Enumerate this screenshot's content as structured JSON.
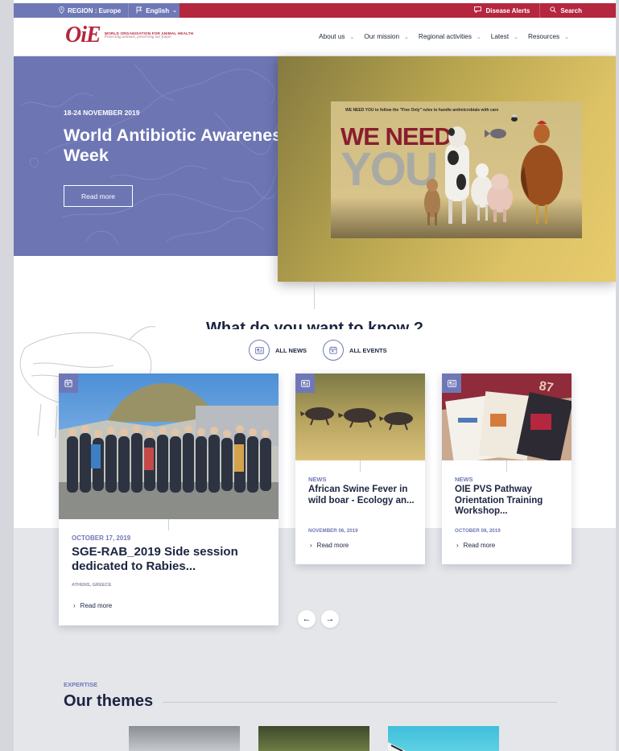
{
  "topbar": {
    "region_label": "REGION : Europe",
    "language_label": "English",
    "disease_alerts_label": "Disease Alerts",
    "search_label": "Search"
  },
  "header": {
    "logo_mark": "OiE",
    "logo_name": "WORLD ORGANISATION FOR ANIMAL HEALTH",
    "logo_tagline": "Protecting animals, preserving our future",
    "nav": [
      {
        "label": "About us"
      },
      {
        "label": "Our mission"
      },
      {
        "label": "Regional activities"
      },
      {
        "label": "Latest"
      },
      {
        "label": "Resources"
      }
    ]
  },
  "hero": {
    "date": "18-24 NOVEMBER 2019",
    "title": "World Antibiotic Awareness Week",
    "button_label": "Read more",
    "poster": {
      "top_text": "WE NEED YOU to follow the \"Five Only\" rules to handle antimicrobials with care",
      "headline_1": "WE NEED",
      "headline_2": "YOU"
    }
  },
  "section_heading": "What do you want to know ?",
  "filters": [
    {
      "label": "ALL NEWS"
    },
    {
      "label": "ALL EVENTS"
    }
  ],
  "cards": [
    {
      "date": "OCTOBER 17, 2019",
      "title": "SGE-RAB_2019 Side session dedicated to Rabies...",
      "location": "ATHENS, GREECE",
      "read_more": "Read more"
    },
    {
      "category": "NEWS",
      "title": "African Swine Fever in wild boar - Ecology an...",
      "date": "NOVEMBER 06, 2019",
      "read_more": "Read more"
    },
    {
      "category": "NEWS",
      "title": "OIE PVS Pathway Orientation Training Workshop...",
      "date": "OCTOBER 08, 2019",
      "read_more": "Read more"
    }
  ],
  "carousel": {
    "prev": "←",
    "next": "→"
  },
  "themes": {
    "eyebrow": "EXPERTISE",
    "title": "Our themes"
  },
  "colors": {
    "brand_red": "#b5263f",
    "accent_blue": "#6f78b7",
    "navy": "#1c2440"
  }
}
